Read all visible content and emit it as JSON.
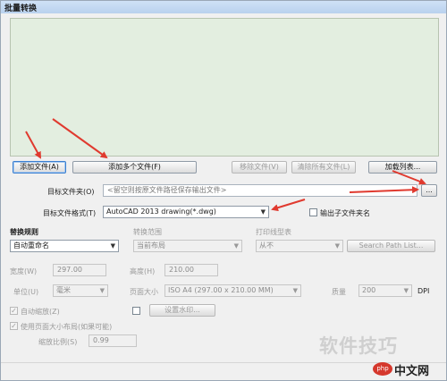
{
  "window": {
    "title": "批量转换"
  },
  "toolbar": {
    "add_file": "添加文件(A)",
    "add_multiple": "添加多个文件(F)",
    "remove_file": "移除文件(V)",
    "clear_all": "清除所有文件(L)",
    "load_list": "加载列表..."
  },
  "target_folder": {
    "label": "目标文件夹(O)",
    "placeholder": "<留空则按原文件路径保存输出文件>",
    "browse_label": "..."
  },
  "target_format": {
    "label": "目标文件格式(T)",
    "value": "AutoCAD 2013 drawing(*.dwg)",
    "output_subfolder_label": "输出子文件夹名"
  },
  "options": {
    "replace_rule_label": "替换规则",
    "replace_rule_value": "自动重命名",
    "layout_label": "转换范围",
    "layout_value": "当前布局",
    "print_style_label": "打印线型表",
    "print_style_value": "从不",
    "search_path_button": "Search Path List...",
    "width_label": "宽度(W)",
    "width_value": "297.00",
    "height_label": "高度(H)",
    "height_value": "210.00",
    "unit_label": "单位(U)",
    "unit_value": "毫米",
    "page_size_label": "页面大小",
    "page_size_value": "ISO A4 (297.00 x 210.00 MM)",
    "quality_label": "质量",
    "quality_value": "200",
    "dpi_label": "DPI",
    "auto_zoom_label": "自动缩放(Z)",
    "watermark_button": "设置水印...",
    "use_page_size_label": "使用页面大小布局(如果可能)",
    "zoom_ratio_label": "缩放比例(S)",
    "zoom_ratio_value": "0.99"
  },
  "watermark": {
    "site_text": "软件技巧",
    "logo_text": "php",
    "brand_text": "中文网"
  },
  "colors": {
    "arrow": "#e03a2f",
    "file_list_bg": "#e3eee0"
  },
  "icons": {
    "checked": "✓",
    "dropdown": "▼"
  }
}
